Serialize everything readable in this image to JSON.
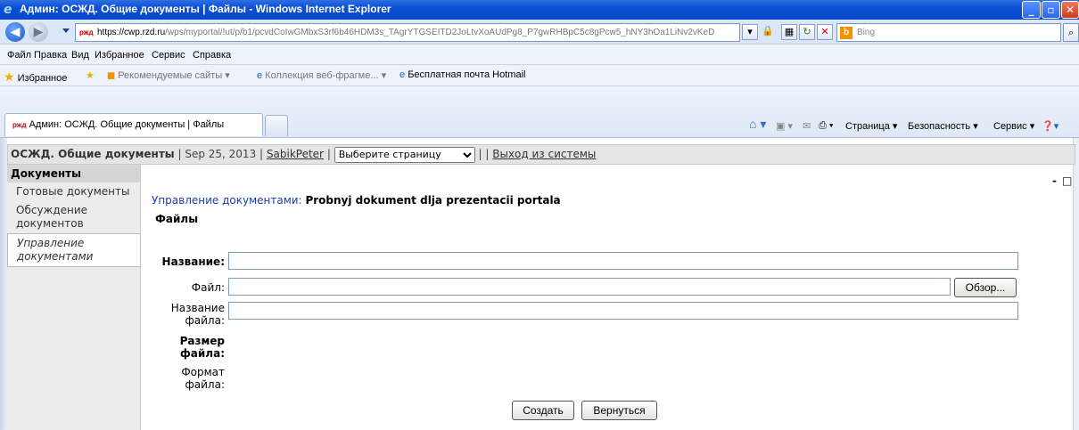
{
  "window": {
    "title": "Админ: ОСЖД. Общие документы | Файлы - Windows Internet Explorer",
    "min": "_",
    "max": "▫",
    "close": "✕"
  },
  "address": {
    "favicon": "ржд",
    "scheme": "https://",
    "host": "cwp.rzd.ru",
    "path": "/wps/myportal/!ut/p/b1/pcvdCoIwGMbxS3rf6b46HDM3s_TAgrYTGSEITD2JoLtvXoAUdPg8_P7gwRHBpC5c8gPcw5_hNY3hOa1LiNv2vKeD",
    "search_placeholder": "Bing"
  },
  "menu": [
    "Файл",
    "Правка",
    "Вид",
    "Избранное",
    "Сервис",
    "Справка"
  ],
  "favorites": {
    "label": "Избранное",
    "items": [
      "Рекомендуемые сайты ▾",
      "Коллекция веб-фрагме... ▾",
      "Бесплатная почта Hotmail"
    ]
  },
  "tab": {
    "favicon": "ржд",
    "label": "Админ: ОСЖД. Общие документы | Файлы"
  },
  "command_bar": [
    "Страница ▾",
    "Безопасность ▾",
    "Сервис ▾"
  ],
  "portal": {
    "home": "ОСЖД. Общие документы",
    "date": "Sep 25, 2013",
    "user": "SabikPeter",
    "page_select": "Выберите страницу",
    "logout": "Выход из системы"
  },
  "leftnav": {
    "header": "Документы",
    "items": [
      "Готовые документы",
      "Обсуждение документов",
      "Управление документами"
    ]
  },
  "content": {
    "crumb_link": "Управление документами:",
    "crumb_doc": "Probnyj dokument dlja prezentacii portala",
    "section": "Файлы",
    "fields": {
      "name": "Название:",
      "file": "Файл:",
      "filename": "Название файла:",
      "size": "Размер файла:",
      "format": "Формат файла:"
    },
    "browse": "Обзор...",
    "create": "Создать",
    "back": "Вернуться"
  }
}
